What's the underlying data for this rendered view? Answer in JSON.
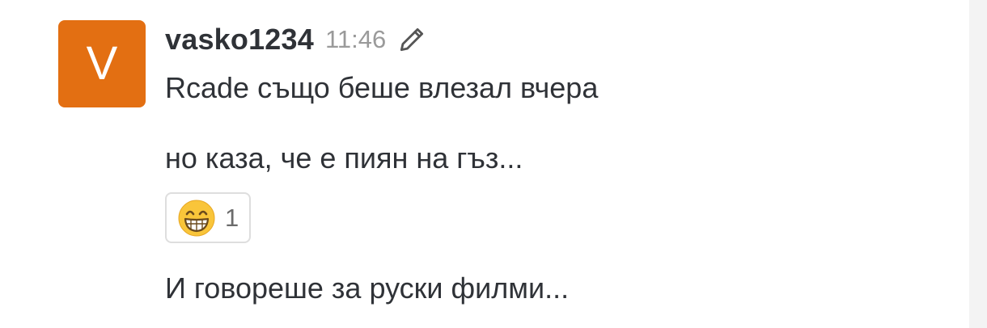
{
  "message": {
    "avatar_letter": "V",
    "avatar_color": "#E36F12",
    "username": "vasko1234",
    "time": "11:46",
    "edit_icon": "pencil-icon",
    "lines": [
      "Rcade също беше влезал вчера",
      "но каза, че е пиян на гъз...",
      "И говореше за руски филми..."
    ],
    "reaction": {
      "emoji": "grinning-face-with-smiling-eyes",
      "count": "1"
    }
  }
}
